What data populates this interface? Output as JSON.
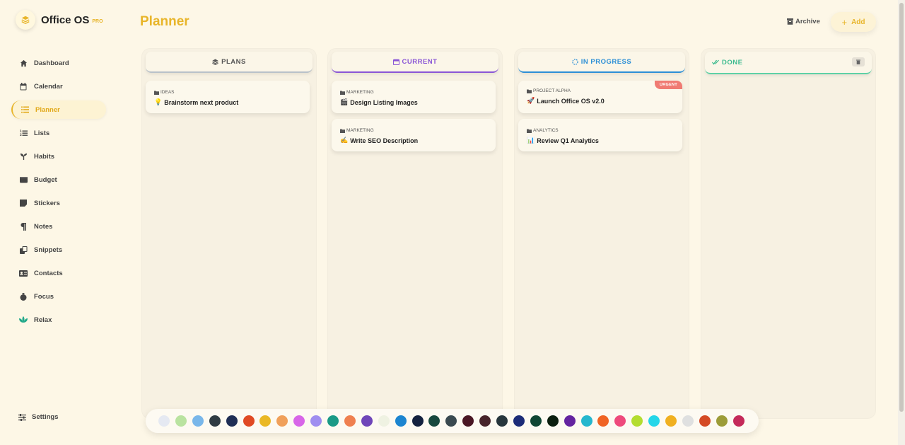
{
  "app": {
    "name": "Office OS",
    "badge": "PRO"
  },
  "sidebar": {
    "items": [
      {
        "label": "Dashboard",
        "icon": "home-icon"
      },
      {
        "label": "Calendar",
        "icon": "calendar-icon"
      },
      {
        "label": "Planner",
        "icon": "planner-icon",
        "active": true
      },
      {
        "label": "Lists",
        "icon": "list-icon"
      },
      {
        "label": "Habits",
        "icon": "sprout-icon"
      },
      {
        "label": "Budget",
        "icon": "wallet-icon"
      },
      {
        "label": "Stickers",
        "icon": "sticky-note-icon"
      },
      {
        "label": "Notes",
        "icon": "paragraph-icon"
      },
      {
        "label": "Snippets",
        "icon": "copy-icon"
      },
      {
        "label": "Contacts",
        "icon": "id-card-icon"
      },
      {
        "label": "Focus",
        "icon": "stopwatch-icon"
      },
      {
        "label": "Relax",
        "icon": "lotus-icon"
      }
    ],
    "settings_label": "Settings"
  },
  "header": {
    "title": "Planner",
    "archive_label": "Archive",
    "add_label": "Add"
  },
  "columns": [
    {
      "title": "PLANS",
      "color": "#555555",
      "accent": "#b9c1c9",
      "cards": [
        {
          "tag": "IDEAS",
          "title": "Brainstorm next product",
          "emoji": "💡"
        }
      ]
    },
    {
      "title": "CURRENT",
      "color": "#8a56d6",
      "accent": "#8a56d6",
      "cards": [
        {
          "tag": "MARKETING",
          "title": "Design Listing Images",
          "emoji": "🎬"
        },
        {
          "tag": "MARKETING",
          "title": "Write SEO Description",
          "emoji": "✍️"
        }
      ]
    },
    {
      "title": "IN PROGRESS",
      "color": "#2c8fd6",
      "accent": "#2c8fd6",
      "cards": [
        {
          "tag": "PROJECT ALPHA",
          "title": "Launch Office OS v2.0",
          "emoji": "🚀",
          "badge": "URGENT"
        },
        {
          "tag": "ANALYTICS",
          "title": "Review Q1 Analytics",
          "emoji": "📊"
        }
      ]
    },
    {
      "title": "DONE",
      "color": "#3dbb8f",
      "accent": "#5fd1a6",
      "cards": []
    }
  ],
  "palette": [
    "#e5e9f2",
    "#b9e3a0",
    "#79b7ea",
    "#2f3b42",
    "#1f2e55",
    "#e04a24",
    "#eab824",
    "#f0a05a",
    "#d866e8",
    "#9f8ef0",
    "#1a9a86",
    "#ef8050",
    "#6f46b9",
    "#eff2e2",
    "#1c85d0",
    "#14223f",
    "#17483d",
    "#3a4a50",
    "#4a1724",
    "#47242a",
    "#27363c",
    "#1c2c78",
    "#0f4633",
    "#0b1f0f",
    "#6424a0",
    "#25b7ce",
    "#f06424",
    "#ee4a7c",
    "#b3dd30",
    "#25d6e8",
    "#f0b020",
    "#dfe0e0",
    "#d44a24",
    "#9c9c38",
    "#c42a5a"
  ]
}
